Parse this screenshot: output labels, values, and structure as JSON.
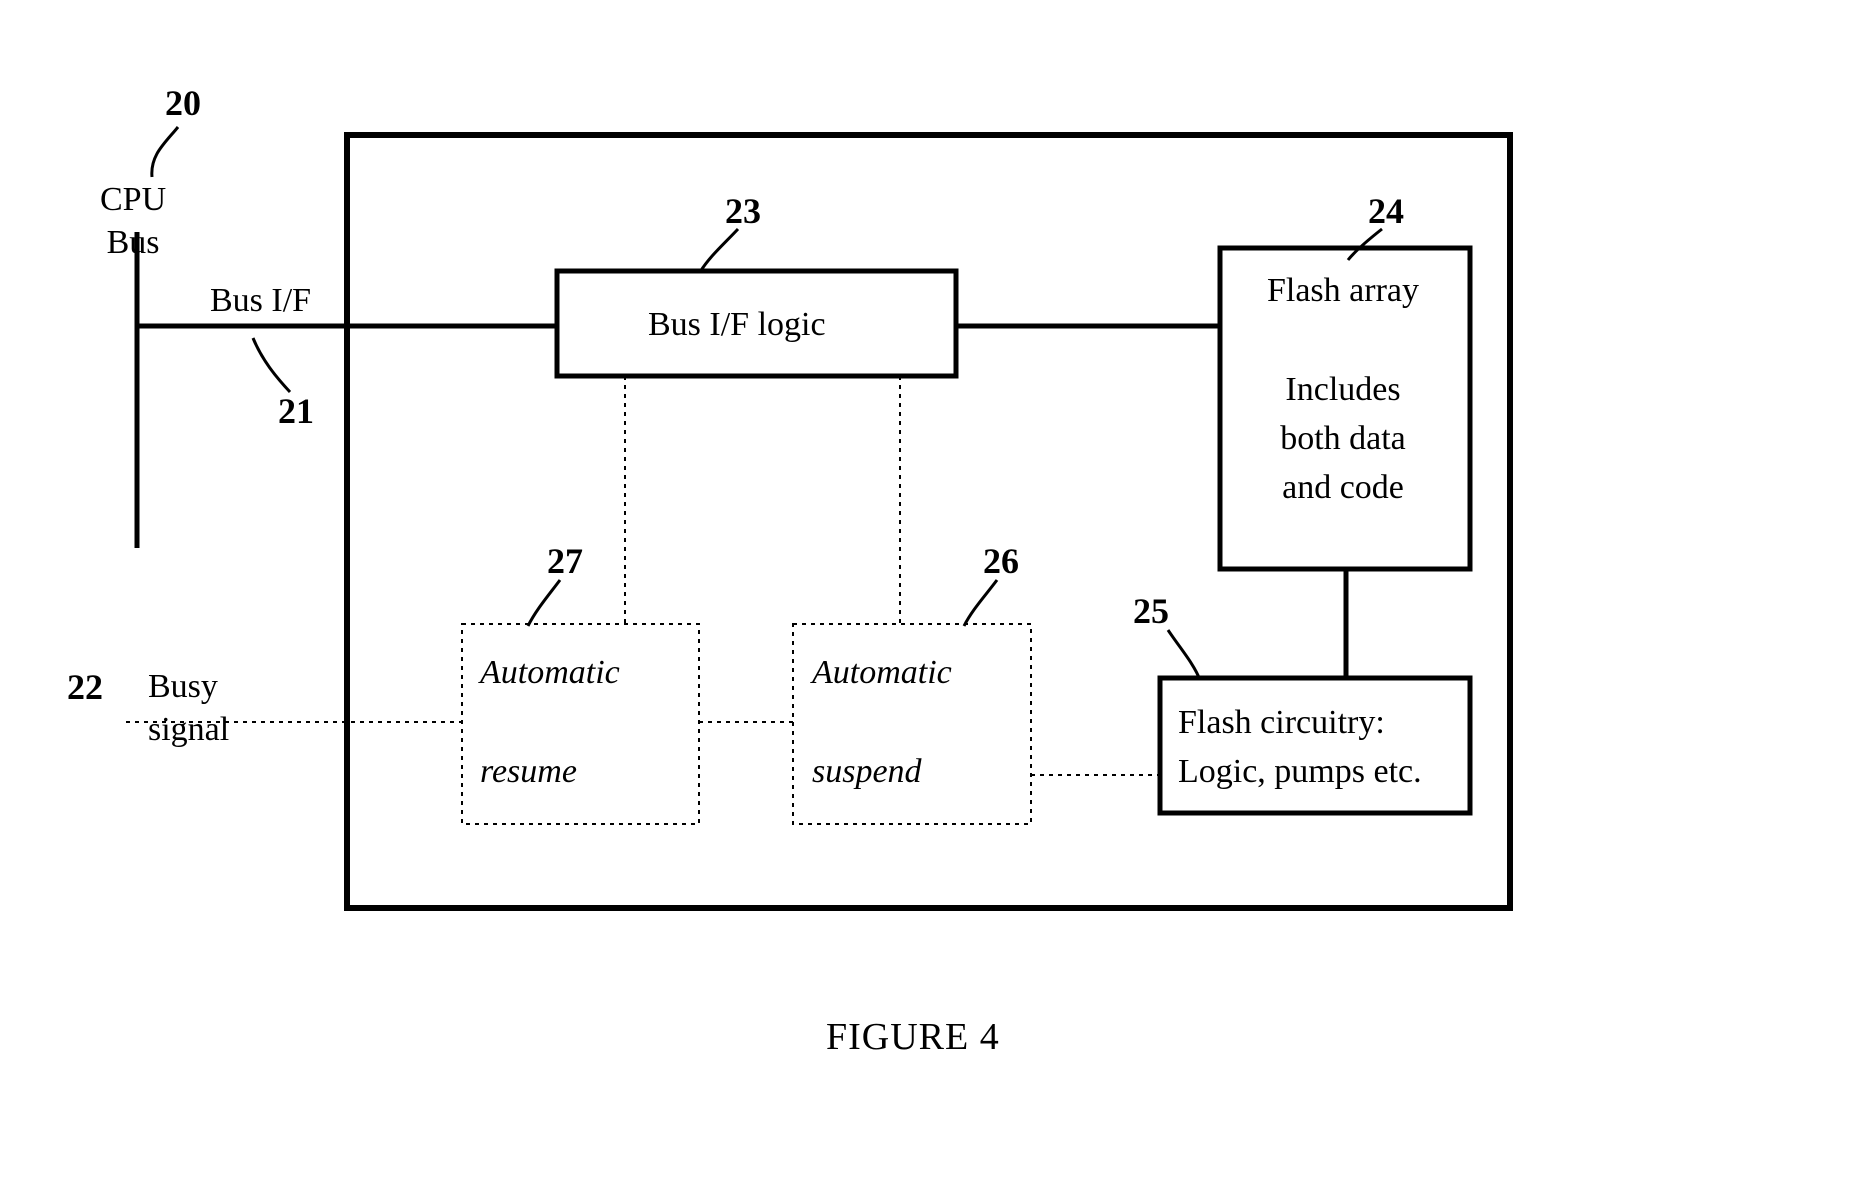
{
  "refs": {
    "n20": "20",
    "n21": "21",
    "n22": "22",
    "n23": "23",
    "n24": "24",
    "n25": "25",
    "n26": "26",
    "n27": "27"
  },
  "labels": {
    "cpu_bus": "CPU\nBus",
    "bus_if": "Bus I/F",
    "busy": "Busy\nsignal",
    "bus_if_logic": "Bus I/F logic",
    "flash_array": "Flash array\n\nIncludes\nboth data\nand code",
    "flash_circuitry": "Flash circuitry:\nLogic, pumps etc.",
    "auto_suspend": "Automatic\n\nsuspend",
    "auto_resume": "Automatic\n\nresume"
  },
  "caption": "FIGURE 4"
}
